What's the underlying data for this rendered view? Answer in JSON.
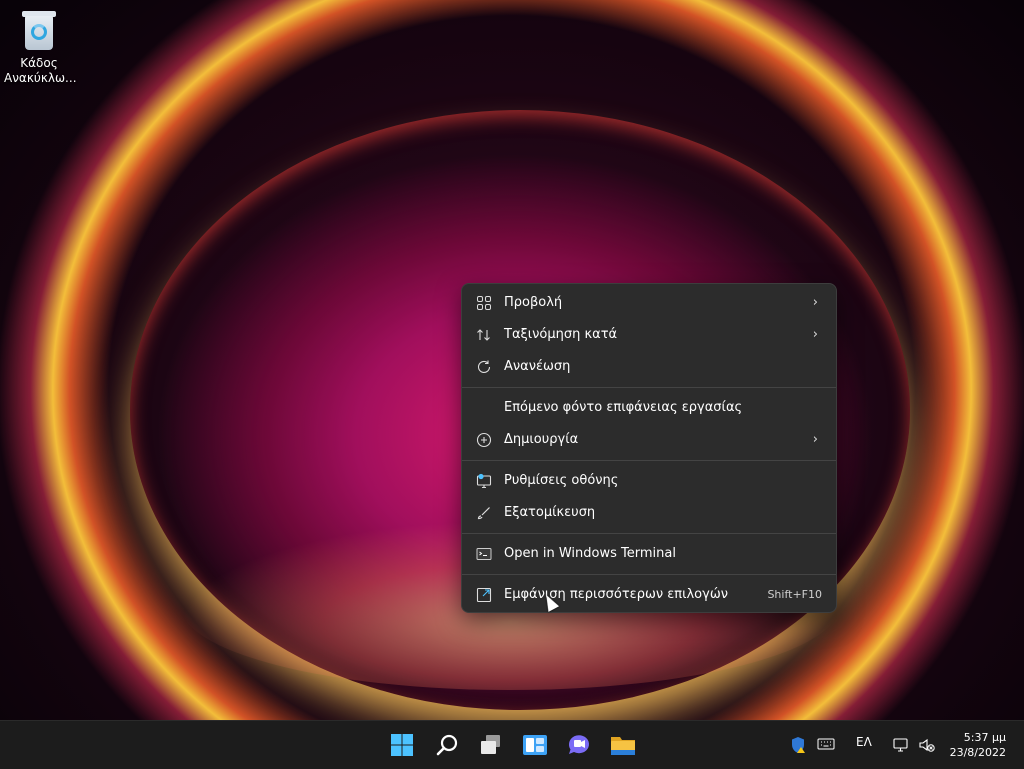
{
  "desktop": {
    "icons": [
      {
        "label_line1": "Κάδος",
        "label_line2": "Ανακύκλω..."
      }
    ]
  },
  "context_menu": {
    "items": [
      {
        "label": "Προβολή",
        "icon": "grid-view-icon",
        "submenu": true
      },
      {
        "label": "Ταξινόμηση κατά",
        "icon": "sort-icon",
        "submenu": true
      },
      {
        "label": "Ανανέωση",
        "icon": "refresh-icon",
        "submenu": false
      },
      {
        "label": "Επόμενο φόντο επιφάνειας εργασίας",
        "icon": "",
        "submenu": false
      },
      {
        "label": "Δημιουργία",
        "icon": "new-plus-icon",
        "submenu": true
      },
      {
        "label": "Ρυθμίσεις οθόνης",
        "icon": "display-settings-icon",
        "submenu": false
      },
      {
        "label": "Εξατομίκευση",
        "icon": "personalize-brush-icon",
        "submenu": false
      },
      {
        "label": "Open in Windows Terminal",
        "icon": "terminal-icon",
        "submenu": false
      },
      {
        "label": "Εμφάνιση περισσότερων επιλογών",
        "icon": "more-options-icon",
        "submenu": false,
        "shortcut": "Shift+F10"
      }
    ],
    "submenu_glyph": "›"
  },
  "taskbar": {
    "apps": [
      "start-button",
      "search-button",
      "task-view-button",
      "widgets-button",
      "chat-button",
      "file-explorer-button"
    ],
    "language": "ΕΛ",
    "time": "5:37 μμ",
    "date": "23/8/2022"
  },
  "colors": {
    "start_blue": "#4cc2ff",
    "menu_bg": "#2c2c2c",
    "taskbar_bg": "#1c1c1c",
    "folder_yellow": "#f6c343",
    "chat_purple": "#7b6cf6"
  }
}
